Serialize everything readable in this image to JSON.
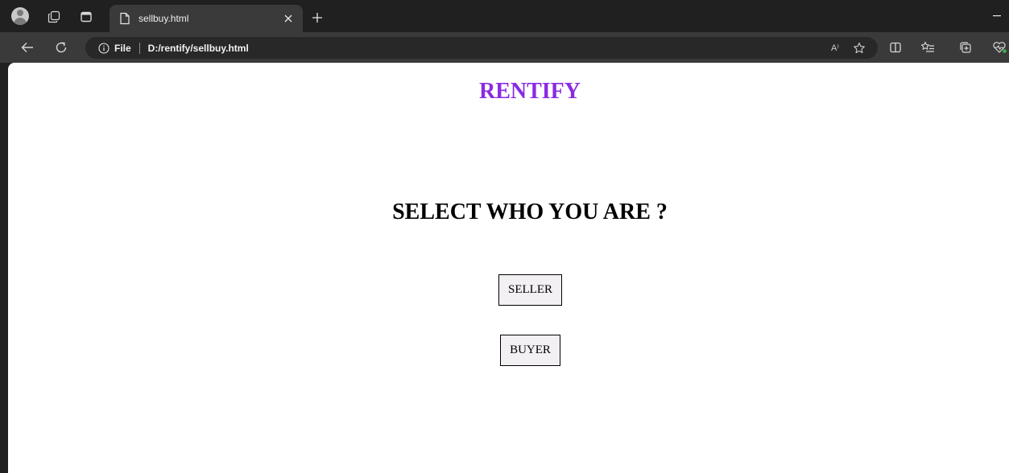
{
  "browser": {
    "tab": {
      "title": "sellbuy.html"
    },
    "address_bar": {
      "site_label": "File",
      "url": "D:/rentify/sellbuy.html",
      "read_aloud_label": "A⁾"
    },
    "icons": {
      "profile": "profile-avatar-icon",
      "workspaces": "workspaces-icon",
      "tab_actions": "tab-actions-icon",
      "page": "page-icon",
      "close": "close-icon",
      "new_tab": "plus-icon",
      "minimize": "minimize-icon",
      "back": "back-arrow-icon",
      "refresh": "refresh-icon",
      "info": "info-icon",
      "favorite": "star-icon",
      "split_screen": "split-screen-icon",
      "favorites": "favorites-list-icon",
      "collections": "collections-icon",
      "copilot": "heart-pulse-icon"
    }
  },
  "page": {
    "brand": "RENTIFY",
    "heading": "SELECT WHO YOU ARE ?",
    "buttons": {
      "seller": "SELLER",
      "buyer": "BUYER"
    },
    "colors": {
      "brand": "#8a2be2",
      "heading": "#000000",
      "button_bg": "#f3f0f3"
    }
  }
}
